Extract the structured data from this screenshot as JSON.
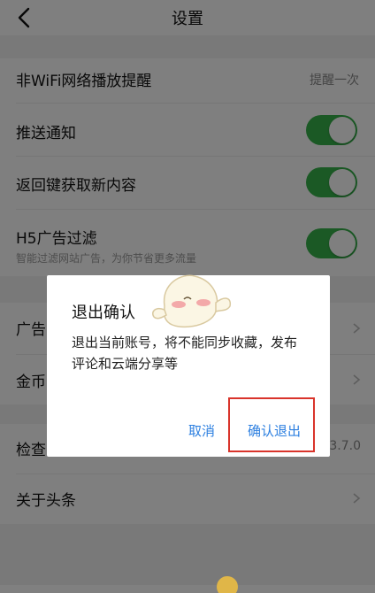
{
  "header": {
    "title": "设置"
  },
  "settings": {
    "wifi_reminder": {
      "label": "非WiFi网络播放提醒",
      "value": "提醒一次"
    },
    "push": {
      "label": "推送通知",
      "enabled": true
    },
    "back_refresh": {
      "label": "返回键获取新内容",
      "enabled": true
    },
    "h5_filter": {
      "label": "H5广告过滤",
      "desc": "智能过滤网站广告，为你节省更多流量",
      "enabled": true
    },
    "ads_partial": {
      "label": "广告"
    },
    "coins_partial": {
      "label": "金币"
    },
    "check_partial": {
      "label": "检查",
      "value": "3.7.0"
    },
    "about": {
      "label": "关于头条"
    }
  },
  "dialog": {
    "title": "退出确认",
    "body": "退出当前账号，将不能同步收藏，发布评论和云端分享等",
    "cancel": "取消",
    "confirm": "确认退出"
  },
  "colors": {
    "toggle_on": "#36b24a",
    "link": "#2c7fe0",
    "highlight_box": "#d9342b"
  }
}
